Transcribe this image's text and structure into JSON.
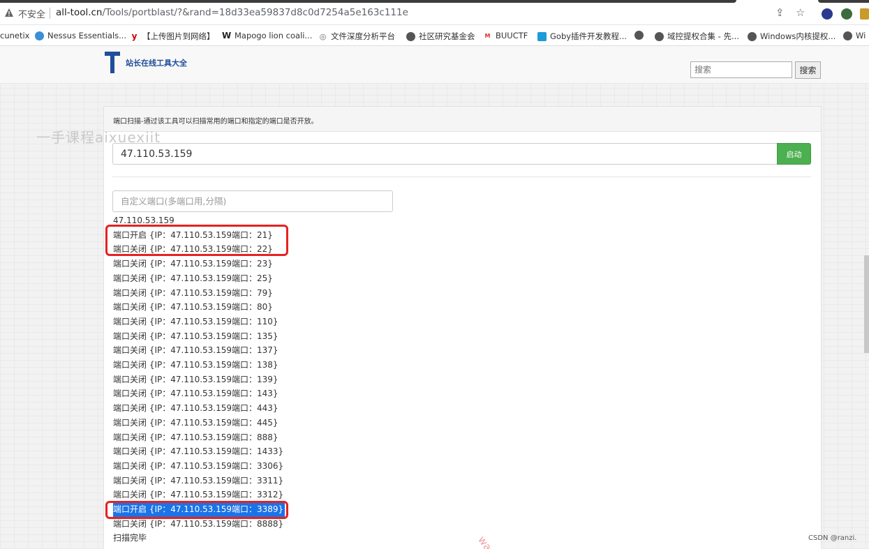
{
  "browser": {
    "insecure_label": "不安全",
    "url_host": "all-tool.cn",
    "url_path": "/Tools/portblast/?&rand=18d33ea59837d8c0d7254a5e163c111e"
  },
  "bookmarks": [
    {
      "label": "cunetix",
      "icon": "globe-icon"
    },
    {
      "label": "Nessus Essentials...",
      "icon": "nessus-icon"
    },
    {
      "label": "【上传图片到网络】",
      "icon": "y-icon"
    },
    {
      "label": "Mapogo lion coali...",
      "icon": "wikipedia-icon"
    },
    {
      "label": "文件深度分析平台",
      "icon": "eye-icon"
    },
    {
      "label": "社区研究基金会",
      "icon": "globe-icon"
    },
    {
      "label": "BUUCTF",
      "icon": "buuctf-icon"
    },
    {
      "label": "Goby插件开发教程...",
      "icon": "bilibili-icon"
    },
    {
      "label": "",
      "icon": "globe-icon"
    },
    {
      "label": "域控提权合集 - 先...",
      "icon": "globe-icon"
    },
    {
      "label": "Windows内核提权...",
      "icon": "globe-icon"
    },
    {
      "label": "Wi",
      "icon": "globe-icon"
    }
  ],
  "site": {
    "logo_text": "站长在线工具大全",
    "search_placeholder": "搜索",
    "search_button": "搜索"
  },
  "tool": {
    "title": "端口扫描-通过该工具可以扫描常用的端口和指定的端口是否开放。",
    "ip_value": "47.110.53.159",
    "start_button": "启动",
    "custom_port_placeholder": "自定义端口(多端口用,分隔)",
    "target_line": "47.110.53.159",
    "results": [
      "端口开启 {IP：47.110.53.159端口：21}",
      "端口关闭 {IP：47.110.53.159端口：22}",
      "端口关闭 {IP：47.110.53.159端口：23}",
      "端口关闭 {IP：47.110.53.159端口：25}",
      "端口关闭 {IP：47.110.53.159端口：79}",
      "端口关闭 {IP：47.110.53.159端口：80}",
      "端口关闭 {IP：47.110.53.159端口：110}",
      "端口关闭 {IP：47.110.53.159端口：135}",
      "端口关闭 {IP：47.110.53.159端口：137}",
      "端口关闭 {IP：47.110.53.159端口：138}",
      "端口关闭 {IP：47.110.53.159端口：139}",
      "端口关闭 {IP：47.110.53.159端口：143}",
      "端口关闭 {IP：47.110.53.159端口：443}",
      "端口关闭 {IP：47.110.53.159端口：445}",
      "端口关闭 {IP：47.110.53.159端口：888}",
      "端口关闭 {IP：47.110.53.159端口：1433}",
      "端口关闭 {IP：47.110.53.159端口：3306}",
      "端口关闭 {IP：47.110.53.159端口：3311}",
      "端口关闭 {IP：47.110.53.159端口：3312}",
      "端口开启 {IP：47.110.53.159端口：3389}",
      "端口关闭 {IP：47.110.53.159端口：8888}"
    ],
    "done_text": "扫描完毕"
  },
  "watermarks": {
    "top": "一手课程aixuexiit",
    "diag": "wa",
    "csdn": "CSDN @ranzi."
  },
  "colors": {
    "accent_green": "#4caf50",
    "highlight_red": "#e52222",
    "selection_blue": "#1a73e8"
  }
}
